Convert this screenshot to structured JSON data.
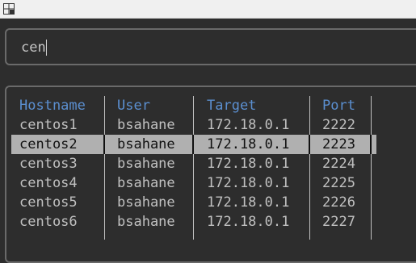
{
  "search": {
    "value": "cen"
  },
  "table": {
    "columns": [
      "Hostname",
      "User",
      "Target",
      "Port"
    ],
    "rows": [
      {
        "hostname": "centos1",
        "user": "bsahane",
        "target": "172.18.0.1",
        "port": "2222"
      },
      {
        "hostname": "centos2",
        "user": "bsahane",
        "target": "172.18.0.1",
        "port": "2223"
      },
      {
        "hostname": "centos3",
        "user": "bsahane",
        "target": "172.18.0.1",
        "port": "2224"
      },
      {
        "hostname": "centos4",
        "user": "bsahane",
        "target": "172.18.0.1",
        "port": "2225"
      },
      {
        "hostname": "centos5",
        "user": "bsahane",
        "target": "172.18.0.1",
        "port": "2226"
      },
      {
        "hostname": "centos6",
        "user": "bsahane",
        "target": "172.18.0.1",
        "port": "2227"
      }
    ],
    "selected_hostname": "centos2"
  },
  "colors": {
    "background": "#2d2d2d",
    "header_text": "#5b8fd0",
    "row_text": "#c0c0c0",
    "selection_bg": "#b0b0b0",
    "border": "#6a6a6a"
  },
  "icons": {
    "window_menu": "window-menu-icon"
  }
}
